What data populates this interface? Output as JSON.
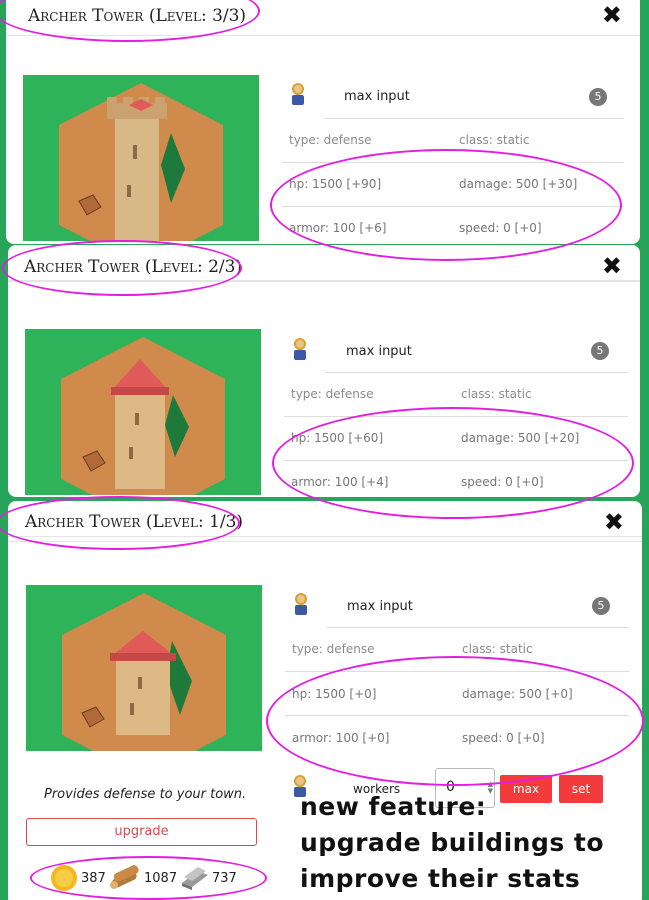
{
  "colors": {
    "background": "#27a55a",
    "accent_ellipse": "#e21fe0",
    "button_red": "#f33b3b",
    "badge": "#777777"
  },
  "panels": [
    {
      "title": "Archer Tower (Level: 3/3)",
      "close_icon": "close-icon",
      "max_input_label": "max input",
      "badge": "5",
      "stats": {
        "type": "type: defense",
        "class": "class: static",
        "hp": "hp: 1500 [+90]",
        "damage": "damage: 500 [+30]",
        "armor": "armor: 100 [+6]",
        "speed": "speed: 0 [+0]"
      }
    },
    {
      "title": "Archer Tower (Level: 2/3)",
      "close_icon": "close-icon",
      "max_input_label": "max input",
      "badge": "5",
      "stats": {
        "type": "type: defense",
        "class": "class: static",
        "hp": "hp: 1500 [+60]",
        "damage": "damage: 500 [+20]",
        "armor": "armor: 100 [+4]",
        "speed": "speed: 0 [+0]"
      }
    },
    {
      "title": "Archer Tower (Level: 1/3)",
      "close_icon": "close-icon",
      "max_input_label": "max input",
      "badge": "5",
      "stats": {
        "type": "type: defense",
        "class": "class: static",
        "hp": "hp: 1500 [+0]",
        "damage": "damage: 500 [+0]",
        "armor": "armor: 100 [+0]",
        "speed": "speed: 0 [+0]"
      },
      "description": "Provides defense to your town.",
      "upgrade_label": "upgrade",
      "resources": {
        "gold": "387",
        "wood": "1087",
        "iron": "737"
      },
      "workers": {
        "label": "workers",
        "value": "0",
        "max_label": "max",
        "set_label": "set"
      }
    }
  ],
  "caption": {
    "line1": "new feature:",
    "line2": "upgrade buildings to",
    "line3": "improve their stats"
  }
}
